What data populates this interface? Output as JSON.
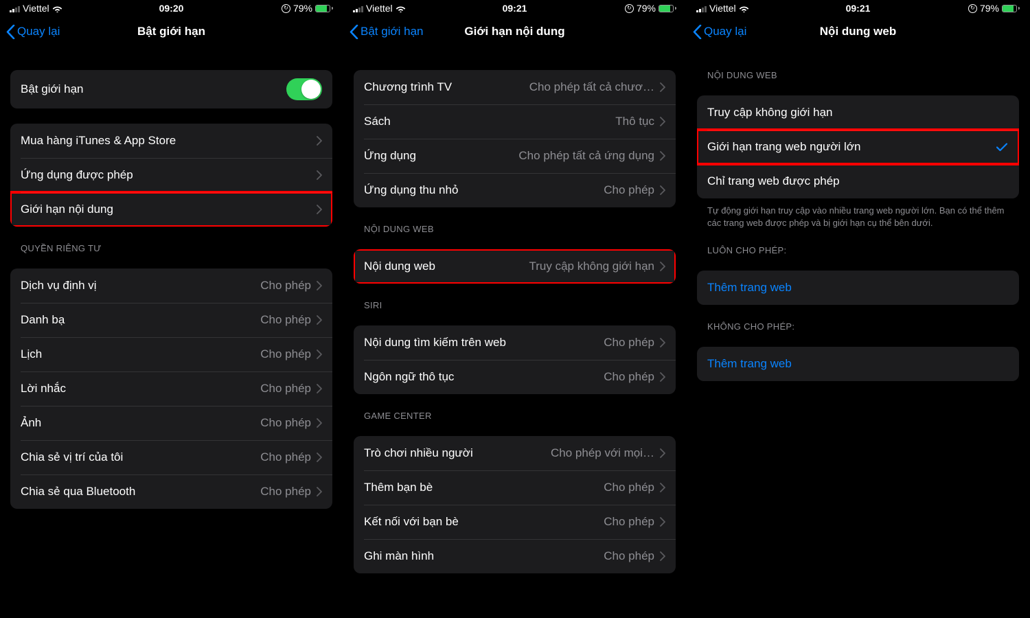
{
  "status": {
    "carrier": "Viettel",
    "battery_percent": "79%",
    "battery_fill": 79,
    "signal_bars_on": 2
  },
  "phones": [
    {
      "time": "09:20",
      "back_label": "Quay lại",
      "title": "Bật giới hạn",
      "groups": [
        {
          "header": null,
          "rows": [
            {
              "label": "Bật giới hạn",
              "type": "switch",
              "on": true,
              "name": "enable-restrictions-switch"
            }
          ]
        },
        {
          "header": null,
          "rows": [
            {
              "label": "Mua hàng iTunes & App Store",
              "type": "nav",
              "name": "row-itunes-appstore"
            },
            {
              "label": "Ứng dụng được phép",
              "type": "nav",
              "name": "row-allowed-apps"
            },
            {
              "label": "Giới hạn nội dung",
              "type": "nav",
              "name": "row-content-restrictions",
              "highlight": true
            }
          ]
        },
        {
          "header": "QUYỀN RIÊNG TƯ",
          "rows": [
            {
              "label": "Dịch vụ định vị",
              "value": "Cho phép",
              "type": "nav",
              "name": "row-location-services"
            },
            {
              "label": "Danh bạ",
              "value": "Cho phép",
              "type": "nav",
              "name": "row-contacts"
            },
            {
              "label": "Lịch",
              "value": "Cho phép",
              "type": "nav",
              "name": "row-calendars"
            },
            {
              "label": "Lời nhắc",
              "value": "Cho phép",
              "type": "nav",
              "name": "row-reminders"
            },
            {
              "label": "Ảnh",
              "value": "Cho phép",
              "type": "nav",
              "name": "row-photos"
            },
            {
              "label": "Chia sẻ vị trí của tôi",
              "value": "Cho phép",
              "type": "nav",
              "name": "row-share-my-location"
            },
            {
              "label": "Chia sẻ qua Bluetooth",
              "value": "Cho phép",
              "type": "nav",
              "name": "row-bluetooth-sharing"
            }
          ]
        }
      ]
    },
    {
      "time": "09:21",
      "back_label": "Bật giới hạn",
      "title": "Giới hạn nội dung",
      "groups": [
        {
          "header": null,
          "rows": [
            {
              "label": "Chương trình TV",
              "value": "Cho phép tất cả chươ…",
              "type": "nav",
              "name": "row-tv-shows"
            },
            {
              "label": "Sách",
              "value": "Thô tục",
              "type": "nav",
              "name": "row-books"
            },
            {
              "label": "Ứng dụng",
              "value": "Cho phép tất cả ứng dụng",
              "type": "nav",
              "name": "row-apps"
            },
            {
              "label": "Ứng dụng thu nhỏ",
              "value": "Cho phép",
              "type": "nav",
              "name": "row-app-clips"
            }
          ]
        },
        {
          "header": "NỘI DUNG WEB",
          "rows": [
            {
              "label": "Nội dung web",
              "value": "Truy cập không giới hạn",
              "type": "nav",
              "name": "row-web-content",
              "highlight": true
            }
          ]
        },
        {
          "header": "SIRI",
          "rows": [
            {
              "label": "Nội dung tìm kiếm trên web",
              "value": "Cho phép",
              "type": "nav",
              "name": "row-web-search-content"
            },
            {
              "label": "Ngôn ngữ thô tục",
              "value": "Cho phép",
              "type": "nav",
              "name": "row-explicit-language"
            }
          ]
        },
        {
          "header": "GAME CENTER",
          "rows": [
            {
              "label": "Trò chơi nhiều người",
              "value": "Cho phép với mọi…",
              "type": "nav",
              "name": "row-multiplayer"
            },
            {
              "label": "Thêm bạn bè",
              "value": "Cho phép",
              "type": "nav",
              "name": "row-adding-friends"
            },
            {
              "label": "Kết nối với bạn bè",
              "value": "Cho phép",
              "type": "nav",
              "name": "row-connect-friends"
            },
            {
              "label": "Ghi màn hình",
              "value": "Cho phép",
              "type": "nav",
              "name": "row-screen-recording"
            }
          ]
        }
      ]
    },
    {
      "time": "09:21",
      "back_label": "Quay lại",
      "title": "Nội dung web",
      "groups": [
        {
          "header": "NỘI DUNG WEB",
          "rows": [
            {
              "label": "Truy cập không giới hạn",
              "type": "option",
              "name": "option-unrestricted"
            },
            {
              "label": "Giới hạn trang web người lớn",
              "type": "option",
              "checked": true,
              "highlight": true,
              "name": "option-limit-adult"
            },
            {
              "label": "Chỉ trang web được phép",
              "type": "option",
              "name": "option-allowed-only"
            }
          ],
          "footer": "Tự động giới hạn truy cập vào nhiều trang web người lớn. Bạn có thể thêm các trang web được phép và bị giới hạn cụ thể bên dưới."
        },
        {
          "header": "LUÔN CHO PHÉP:",
          "rows": [
            {
              "label": "Thêm trang web",
              "type": "link",
              "name": "add-website-allow"
            }
          ]
        },
        {
          "header": "KHÔNG CHO PHÉP:",
          "rows": [
            {
              "label": "Thêm trang web",
              "type": "link",
              "name": "add-website-deny"
            }
          ]
        }
      ]
    }
  ]
}
